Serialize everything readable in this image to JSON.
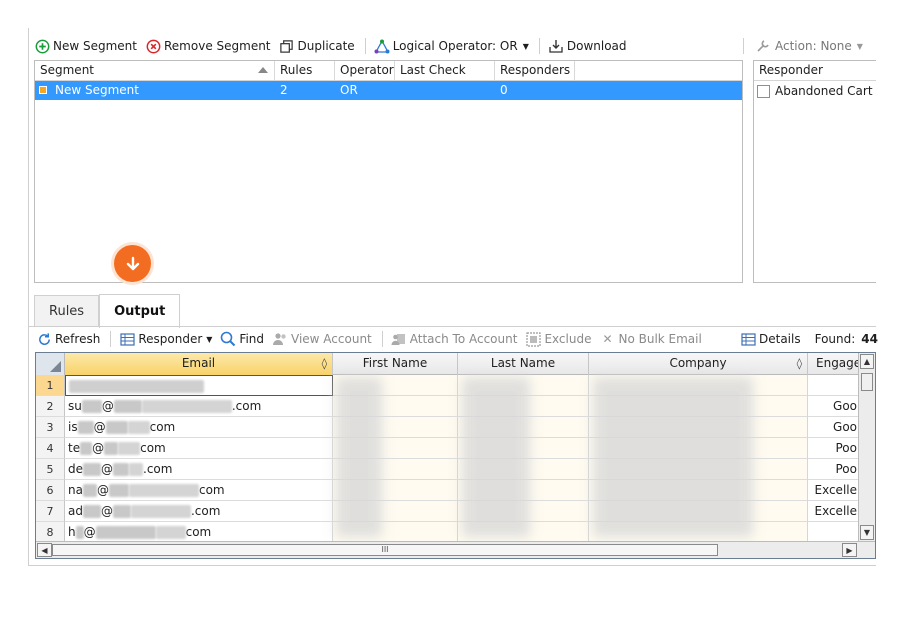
{
  "toolbar": {
    "new_segment": "New Segment",
    "remove_segment": "Remove Segment",
    "duplicate": "Duplicate",
    "logical_operator": "Logical Operator: OR",
    "download": "Download",
    "action": "Action: None"
  },
  "segments": {
    "columns": [
      "Segment",
      "Rules",
      "Operator",
      "Last Check",
      "Responders"
    ],
    "rows": [
      {
        "segment": "New Segment",
        "rules": "2",
        "operator": "OR",
        "last_check": "",
        "responders": "0"
      }
    ]
  },
  "responder_panel": {
    "header": "Responder",
    "items": [
      "Abandoned Cart and"
    ]
  },
  "tabs": [
    "Rules",
    "Output"
  ],
  "active_tab": "Output",
  "output_toolbar": {
    "refresh": "Refresh",
    "responder": "Responder",
    "find": "Find",
    "view_account": "View Account",
    "attach_to_account": "Attach To Account",
    "exclude": "Exclude",
    "no_bulk_email": "No Bulk Email",
    "details": "Details",
    "found_label": "Found:",
    "found_value": "44"
  },
  "output_grid": {
    "columns": [
      "Email",
      "First Name",
      "Last Name",
      "Company",
      "Engager"
    ],
    "rows": [
      {
        "n": "1",
        "email_prefix": "",
        "email_mid": "",
        "email_suffix": "",
        "engagement": ""
      },
      {
        "n": "2",
        "email_prefix": "su",
        "email_mid": "@",
        "email_suffix": ".com",
        "engagement": "Goo"
      },
      {
        "n": "3",
        "email_prefix": "is",
        "email_mid": "@",
        "email_suffix": "com",
        "engagement": "Goo"
      },
      {
        "n": "4",
        "email_prefix": "te",
        "email_mid": "@",
        "email_suffix": "com",
        "engagement": "Poo"
      },
      {
        "n": "5",
        "email_prefix": "de",
        "email_mid": "@",
        "email_suffix": ".com",
        "engagement": "Poo"
      },
      {
        "n": "6",
        "email_prefix": "na",
        "email_mid": "@",
        "email_suffix": "com",
        "engagement": "Excelle"
      },
      {
        "n": "7",
        "email_prefix": "ad",
        "email_mid": "@",
        "email_suffix": ".com",
        "engagement": "Excelle"
      },
      {
        "n": "8",
        "email_prefix": "h",
        "email_mid": "@",
        "email_suffix": "com",
        "engagement": ""
      }
    ]
  },
  "scrollbar": {
    "h_thumb_grip": "III"
  },
  "colors": {
    "selection": "#3399ff",
    "badge": "#f26d21",
    "email_header": "#f8d36a",
    "add_icon": "#1a9c3a",
    "remove_icon": "#d9262b"
  }
}
